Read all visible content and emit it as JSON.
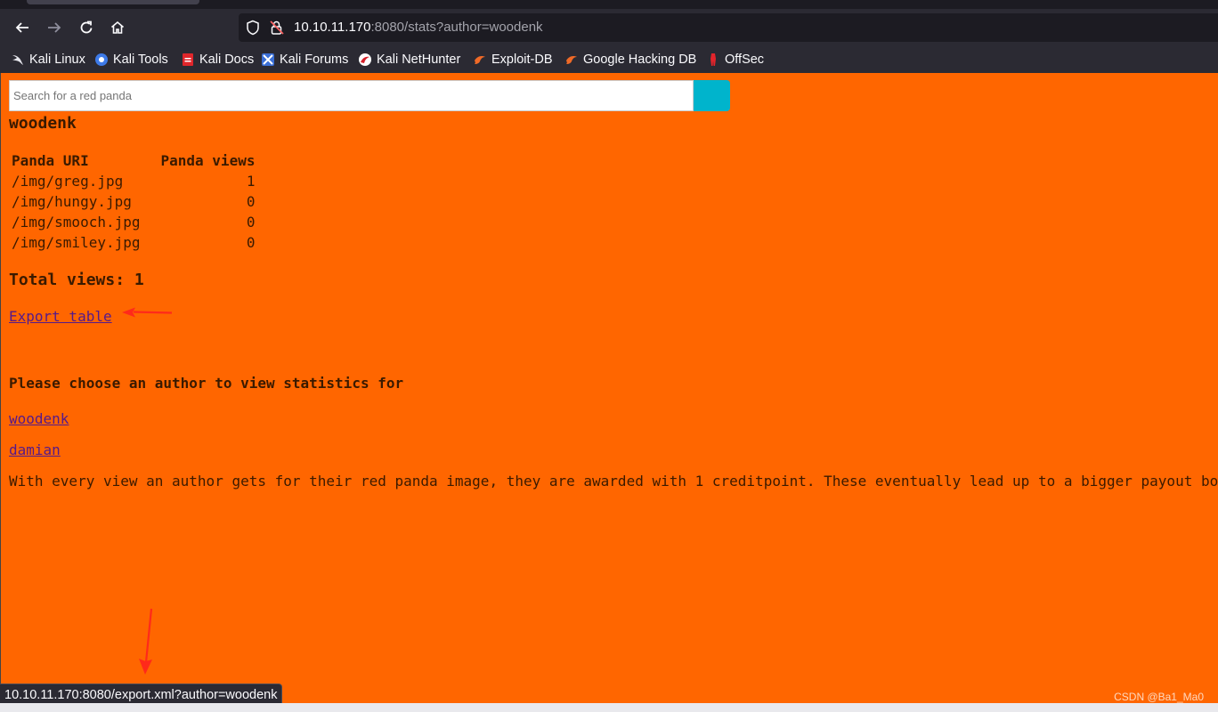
{
  "browser": {
    "url": {
      "host": "10.10.11.170",
      "rest": ":8080/stats?author=woodenk"
    },
    "bookmarks": [
      {
        "label": "Kali Linux",
        "icon": "kali-dragon-icon"
      },
      {
        "label": "Kali Tools",
        "icon": "kali-tools-icon"
      },
      {
        "label": "Kali Docs",
        "icon": "kali-docs-icon"
      },
      {
        "label": "Kali Forums",
        "icon": "kali-forums-icon"
      },
      {
        "label": "Kali NetHunter",
        "icon": "kali-nethunter-icon"
      },
      {
        "label": "Exploit-DB",
        "icon": "exploit-db-icon"
      },
      {
        "label": "Google Hacking DB",
        "icon": "ghdb-icon"
      },
      {
        "label": "OffSec",
        "icon": "offsec-icon"
      }
    ],
    "status_text": "10.10.11.170:8080/export.xml?author=woodenk"
  },
  "colors": {
    "page_background": "#ff6600",
    "search_button": "#00b4cc",
    "link": "#551a8b",
    "annotation_arrow": "#ff2a1a"
  },
  "page": {
    "search": {
      "placeholder": "Search for a red panda"
    },
    "author_name": "woodenk",
    "table": {
      "headers": [
        "Panda URI",
        "Panda views"
      ],
      "rows": [
        {
          "uri": "/img/greg.jpg",
          "views": "1"
        },
        {
          "uri": "/img/hungy.jpg",
          "views": "0"
        },
        {
          "uri": "/img/smooch.jpg",
          "views": "0"
        },
        {
          "uri": "/img/smiley.jpg",
          "views": "0"
        }
      ]
    },
    "total_views": "Total views: 1",
    "export_link": "Export table",
    "choose_heading": "Please choose an author to view statistics for",
    "authors": [
      "woodenk",
      "damian"
    ],
    "info": "With every view an author gets for their red panda image, they are awarded with 1 creditpoint. These eventually lead up to a bigger payout bo"
  },
  "watermark": "CSDN @Ba1_Ma0"
}
